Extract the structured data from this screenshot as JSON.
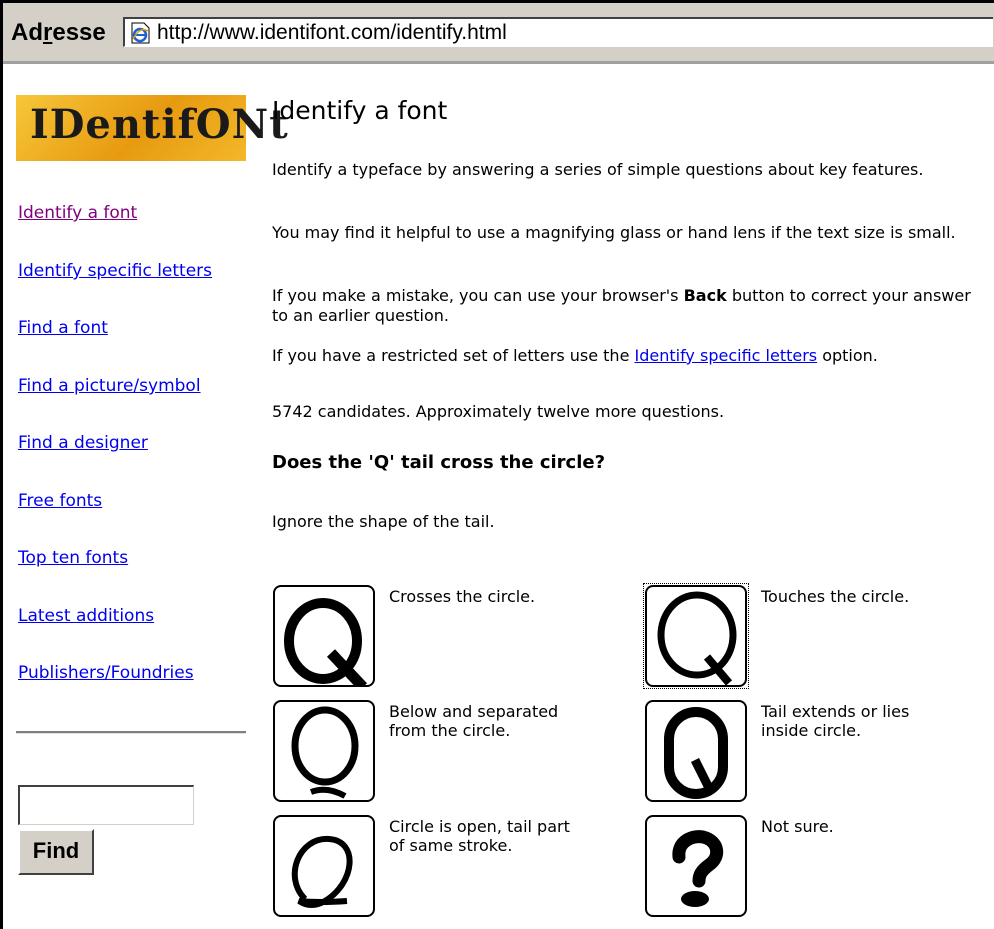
{
  "browser": {
    "address_label_prefix": "Ad",
    "address_label_underlined": "r",
    "address_label_suffix": "esse",
    "url": "http://www.identifont.com/identify.html"
  },
  "sidebar": {
    "logo_text": "IDentifONt",
    "nav": [
      {
        "label": "Identify a font",
        "visited": true
      },
      {
        "label": "Identify specific letters",
        "visited": false
      },
      {
        "label": "Find a font",
        "visited": false
      },
      {
        "label": "Find a picture/symbol",
        "visited": false
      },
      {
        "label": "Find a designer",
        "visited": false
      },
      {
        "label": "Free fonts",
        "visited": false
      },
      {
        "label": "Top ten fonts",
        "visited": false
      },
      {
        "label": "Latest additions",
        "visited": false
      },
      {
        "label": "Publishers/Foundries",
        "visited": false
      }
    ],
    "search_value": "",
    "find_label": "Find"
  },
  "main": {
    "title": "Identify a font",
    "intro": "Identify a typeface by answering a series of simple questions about key features.",
    "magnify": "You may find it helpful to use a magnifying glass or hand lens if the text size is small.",
    "mistake_pre": "If you make a mistake, you can use your browser's ",
    "mistake_bold": "Back",
    "mistake_post": " button to correct your answer to an earlier question.",
    "restricted_pre": "If you have a restricted set of letters use the ",
    "restricted_link": "Identify specific letters",
    "restricted_post": " option.",
    "candidates": "5742 candidates. Approximately twelve more questions.",
    "question": "Does the 'Q' tail cross the circle?",
    "hint": "Ignore the shape of the tail.",
    "options": [
      {
        "label": "Crosses the circle.",
        "glyph": "q-crosses-icon"
      },
      {
        "label": "Touches the circle.",
        "glyph": "q-touches-icon"
      },
      {
        "label": "Below and separated from the circle.",
        "glyph": "q-below-icon"
      },
      {
        "label": "Tail extends or lies inside circle.",
        "glyph": "q-inside-icon"
      },
      {
        "label": "Circle is open, tail part of same stroke.",
        "glyph": "q-open-icon"
      },
      {
        "label": "Not sure.",
        "glyph": "question-mark-icon"
      }
    ]
  }
}
